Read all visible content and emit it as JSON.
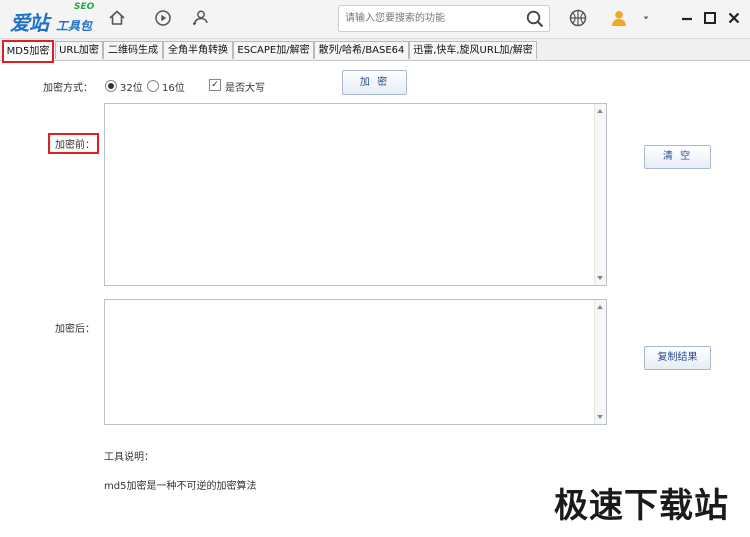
{
  "app": {
    "logo_main": "爱站",
    "logo_sub": "工具包",
    "logo_seo": "SEO"
  },
  "search": {
    "placeholder": "请输入您要搜索的功能"
  },
  "tabs": [
    {
      "label": "MD5加密"
    },
    {
      "label": "URL加密"
    },
    {
      "label": "二维码生成"
    },
    {
      "label": "全角半角转换"
    },
    {
      "label": "ESCAPE加/解密"
    },
    {
      "label": "散列/哈希/BASE64"
    },
    {
      "label": "迅雷,快车,旋风URL加/解密"
    }
  ],
  "form": {
    "method_label": "加密方式：",
    "option_32": "32位",
    "option_16": "16位",
    "uppercase_label": "是否大写",
    "encrypt_button": "加 密",
    "before_label": "加密前：",
    "after_label": "加密后：",
    "clear_button": "清 空",
    "copy_button": "复制结果",
    "before_value": "",
    "after_value": ""
  },
  "help": {
    "title": "工具说明：",
    "text": "md5加密是一种不可逆的加密算法"
  },
  "watermark": "极速下载站",
  "colors": {
    "brand_blue": "#1e73c9",
    "highlight_red": "#e02020",
    "button_text": "#2a4d8f"
  }
}
